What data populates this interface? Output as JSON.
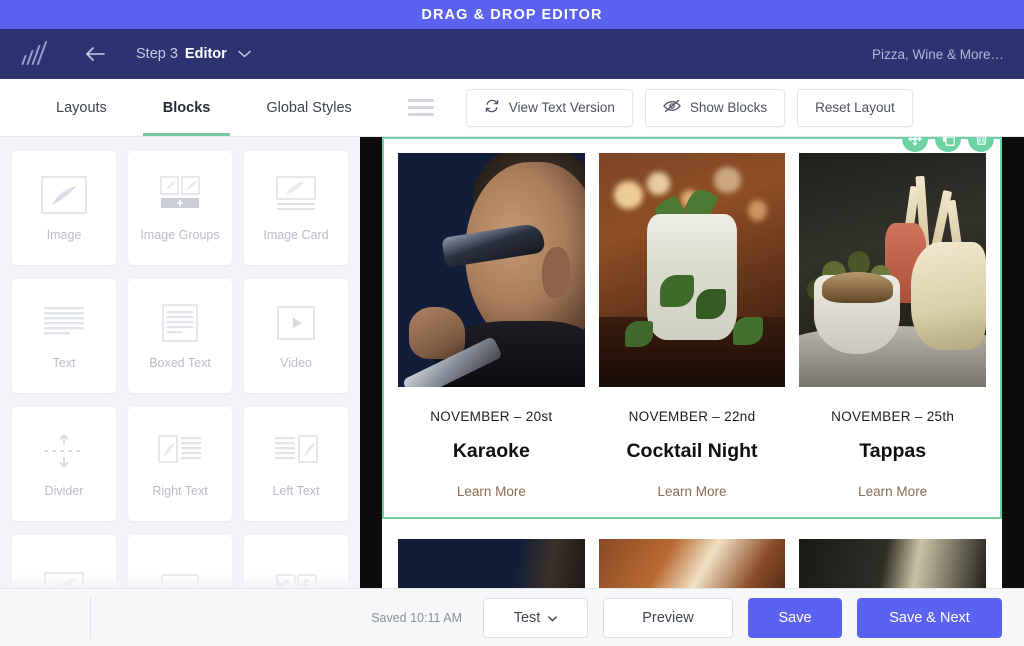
{
  "promo_banner": {
    "text": "DRAG & DROP EDITOR"
  },
  "topnav": {
    "logo_name": "app-logo",
    "back_label": "Back",
    "step_label": "Step 3",
    "step_name": "Editor",
    "campaign_name": "Pizza, Wine & More…"
  },
  "toolbar": {
    "tabs": [
      {
        "label": "Layouts",
        "active": false
      },
      {
        "label": "Blocks",
        "active": true
      },
      {
        "label": "Global Styles",
        "active": false
      }
    ],
    "menu_icon": "hamburger-icon",
    "buttons": [
      {
        "label": "View Text Version",
        "icon": "refresh-icon"
      },
      {
        "label": "Show Blocks",
        "icon": "eye-slash-icon"
      },
      {
        "label": "Reset Layout",
        "icon": ""
      }
    ]
  },
  "sidebar": {
    "blocks": [
      {
        "label": "Image",
        "icon": "image-icon"
      },
      {
        "label": "Image Groups",
        "icon": "image-groups-icon"
      },
      {
        "label": "Image Card",
        "icon": "image-card-icon"
      },
      {
        "label": "Text",
        "icon": "text-icon"
      },
      {
        "label": "Boxed Text",
        "icon": "boxed-text-icon"
      },
      {
        "label": "Video",
        "icon": "video-icon"
      },
      {
        "label": "Divider",
        "icon": "divider-icon"
      },
      {
        "label": "Right Text",
        "icon": "right-text-icon"
      },
      {
        "label": "Left Text",
        "icon": "left-text-icon"
      },
      {
        "label": "",
        "icon": "image-caption-icon"
      },
      {
        "label": "",
        "icon": "button-icon"
      },
      {
        "label": "",
        "icon": "social-icon"
      }
    ]
  },
  "canvas": {
    "block_controls": [
      {
        "name": "move-icon",
        "title": "Move"
      },
      {
        "name": "duplicate-icon",
        "title": "Duplicate"
      },
      {
        "name": "delete-icon",
        "title": "Delete"
      }
    ],
    "cards": [
      {
        "date": "NOVEMBER – 20st",
        "title": "Karaoke",
        "link": "Learn More",
        "photo": "singer-with-microphone"
      },
      {
        "date": "NOVEMBER – 22nd",
        "title": "Cocktail Night",
        "link": "Learn More",
        "photo": "mojito-cocktail"
      },
      {
        "date": "NOVEMBER – 25th",
        "title": "Tappas",
        "link": "Learn More",
        "photo": "tapas-platter"
      }
    ]
  },
  "footer": {
    "saved_text": "Saved 10:11 AM",
    "test_label": "Test",
    "preview_label": "Preview",
    "save_label": "Save",
    "save_next_label": "Save & Next"
  },
  "colors": {
    "banner_purple": "#5a62ef",
    "topnav_navy": "#2c3370",
    "accent_green": "#72cfa3",
    "primary_button": "#5a62ef",
    "link_brown": "#8a6c52"
  }
}
